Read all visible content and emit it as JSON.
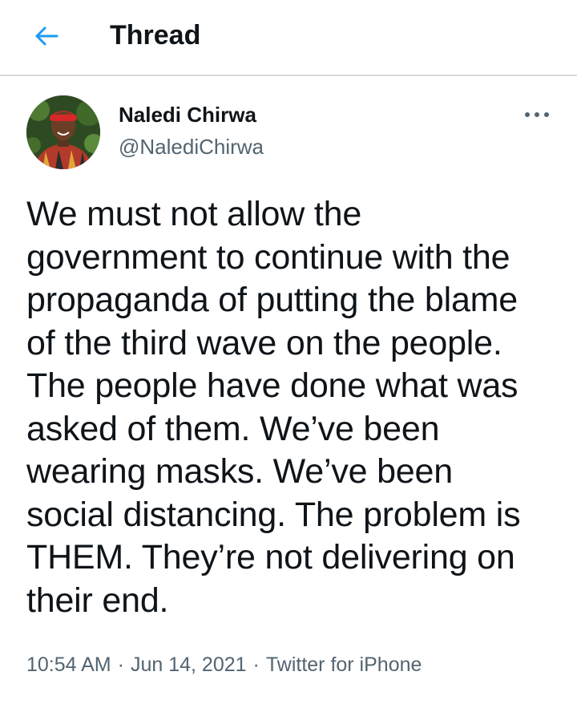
{
  "header": {
    "title": "Thread",
    "back_icon": "arrow-left-icon",
    "accent_color": "#1d9bf0"
  },
  "tweet": {
    "author": {
      "name": "Naledi Chirwa",
      "handle": "@NalediChirwa",
      "avatar_icon": "profile-photo"
    },
    "more_icon": "more-horizontal-icon",
    "text_lines": [
      "We must not allow the",
      "government to continue with the",
      "propaganda of putting the blame",
      "of the third wave on the people.",
      "The people have done what was",
      "asked of them. We’ve been",
      "wearing masks. We’ve been",
      "social distancing. The problem is",
      "THEM. They’re not delivering on",
      "their end."
    ],
    "time": "10:54 AM",
    "date": "Jun 14, 2021",
    "source": "Twitter for iPhone",
    "separator": "·"
  }
}
